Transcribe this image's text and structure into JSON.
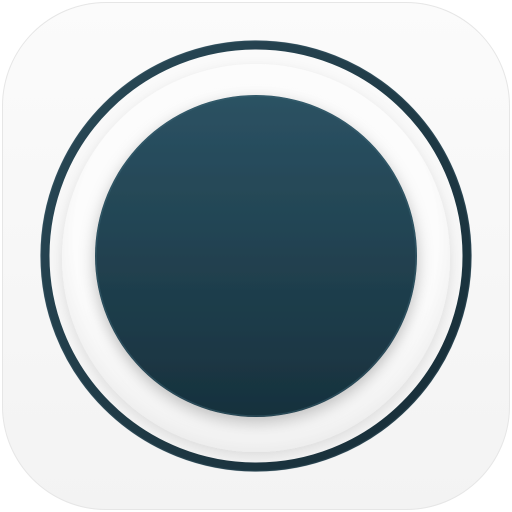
{
  "app_icon": {
    "icon_name": "record-button-icon",
    "colors": {
      "tile_background": "#f5f5f5",
      "ring": "#1f3a47",
      "ring_highlight": "#3a5a68",
      "disc_top": "#2b5263",
      "disc_bottom": "#17313d",
      "inner_plate": "#ffffff"
    }
  }
}
